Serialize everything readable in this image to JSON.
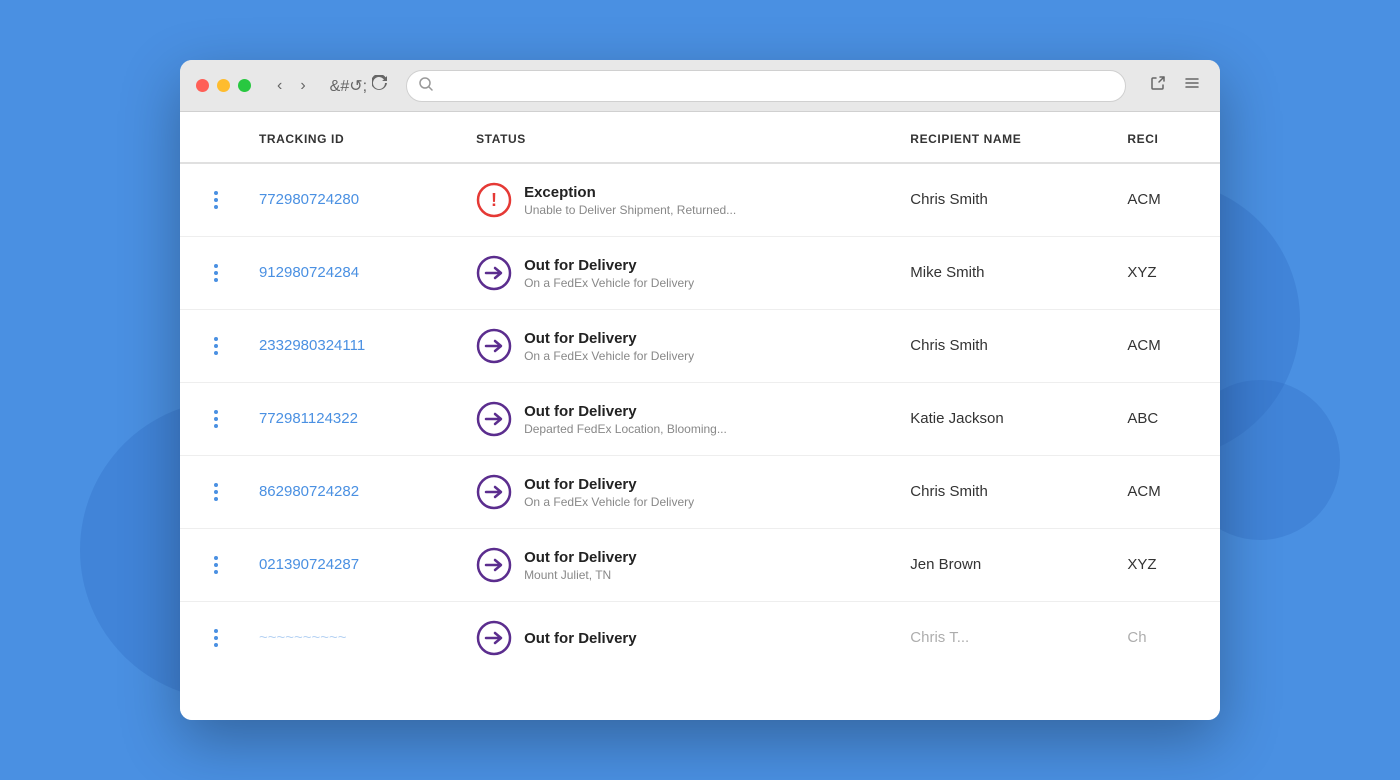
{
  "background": {
    "color": "#4a90e2"
  },
  "browser": {
    "address_placeholder": ""
  },
  "table": {
    "columns": [
      {
        "key": "menu",
        "label": ""
      },
      {
        "key": "tracking_id",
        "label": "TRACKING ID"
      },
      {
        "key": "status",
        "label": "STATUS"
      },
      {
        "key": "recipient_name",
        "label": "RECIPIENT NAME"
      },
      {
        "key": "recipient_code",
        "label": "RECI"
      }
    ],
    "rows": [
      {
        "tracking_id": "772980724280",
        "status_type": "exception",
        "status_title": "Exception",
        "status_sub": "Unable to Deliver Shipment, Returned...",
        "recipient_name": "Chris Smith",
        "recipient_code": "ACM"
      },
      {
        "tracking_id": "912980724284",
        "status_type": "delivery",
        "status_title": "Out for Delivery",
        "status_sub": "On a FedEx Vehicle for Delivery",
        "recipient_name": "Mike Smith",
        "recipient_code": "XYZ"
      },
      {
        "tracking_id": "2332980324111",
        "status_type": "delivery",
        "status_title": "Out for Delivery",
        "status_sub": "On a FedEx Vehicle for Delivery",
        "recipient_name": "Chris Smith",
        "recipient_code": "ACM"
      },
      {
        "tracking_id": "772981124322",
        "status_type": "delivery",
        "status_title": "Out for Delivery",
        "status_sub": "Departed FedEx Location, Blooming...",
        "recipient_name": "Katie Jackson",
        "recipient_code": "ABC"
      },
      {
        "tracking_id": "862980724282",
        "status_type": "delivery",
        "status_title": "Out for Delivery",
        "status_sub": "On a FedEx Vehicle for Delivery",
        "recipient_name": "Chris Smith",
        "recipient_code": "ACM"
      },
      {
        "tracking_id": "021390724287",
        "status_type": "delivery",
        "status_title": "Out for Delivery",
        "status_sub": "Mount Juliet, TN",
        "recipient_name": "Jen Brown",
        "recipient_code": "XYZ"
      },
      {
        "tracking_id": "~~~~~~~~~~",
        "status_type": "delivery",
        "status_title": "Out for Delivery",
        "status_sub": "",
        "recipient_name": "Chris T...",
        "recipient_code": "Ch"
      }
    ]
  }
}
